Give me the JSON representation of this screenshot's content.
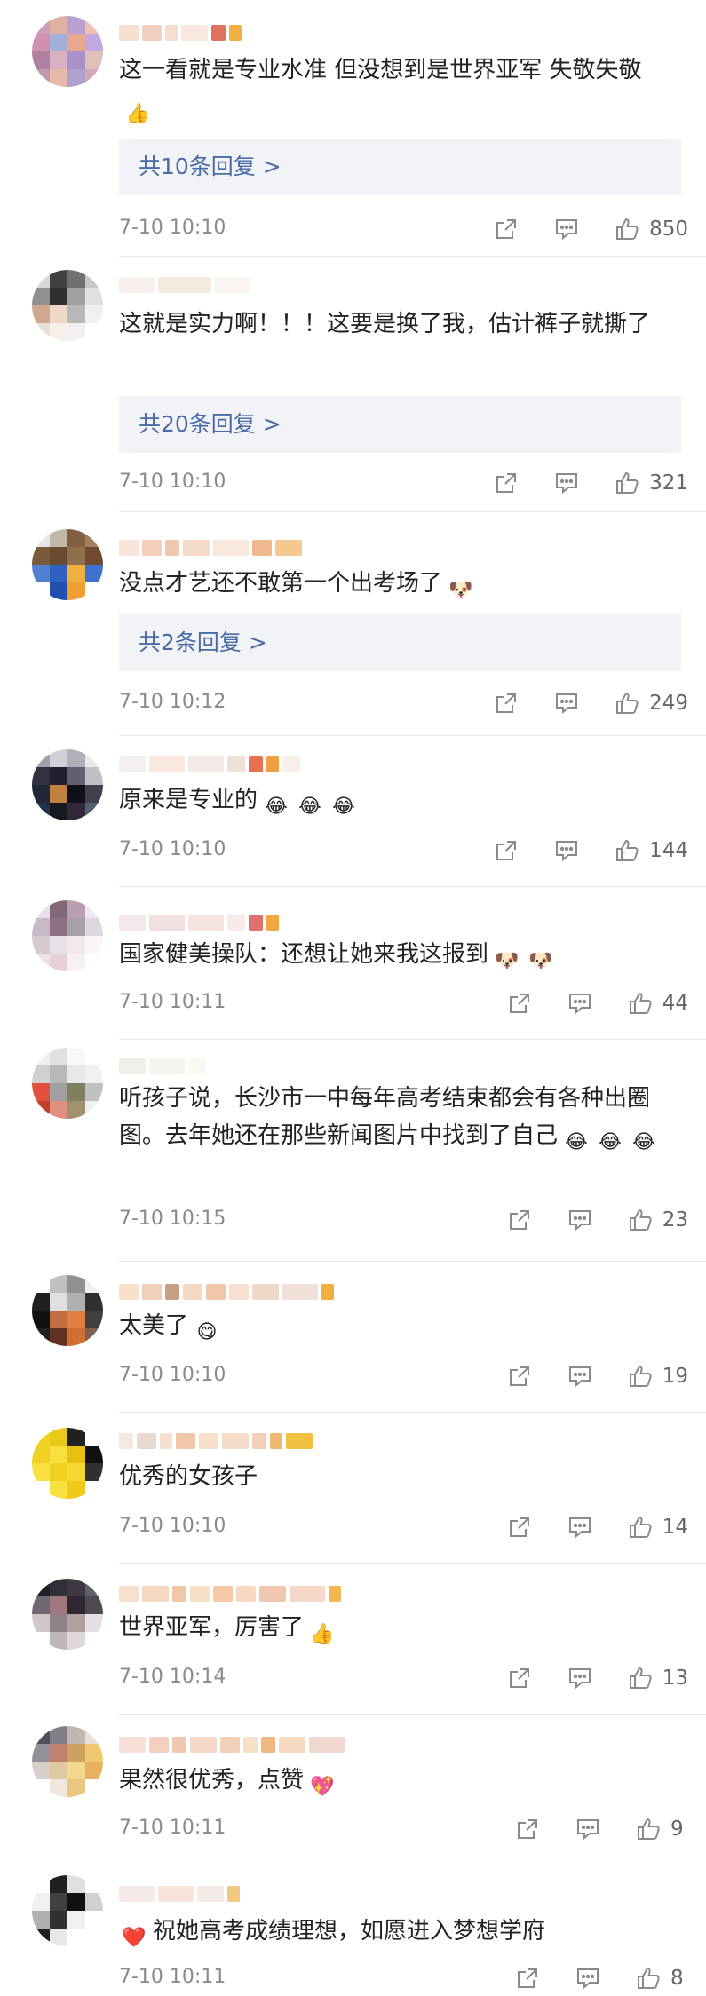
{
  "comments": [
    {
      "text": "这一看就是专业水准 但没想到是世界亚军 失敬失敬",
      "emojis": [
        "👍"
      ],
      "replies": "共10条回复 >",
      "time": "7-10 10:10",
      "likes": "850"
    },
    {
      "text": "这就是实力啊！！！这要是换了我，估计裤子就撕了",
      "emojis": [],
      "replies": "共20条回复 >",
      "time": "7-10 10:10",
      "likes": "321"
    },
    {
      "text": "没点才艺还不敢第一个出考场了",
      "emojis": [
        "🐶"
      ],
      "replies": "共2条回复 >",
      "time": "7-10 10:12",
      "likes": "249"
    },
    {
      "text": "原来是专业的",
      "emojis": [
        "😂",
        "😂",
        "😂"
      ],
      "replies": "",
      "time": "7-10 10:10",
      "likes": "144"
    },
    {
      "text": "国家健美操队：还想让她来我这报到",
      "emojis": [
        "🐶",
        "🐶"
      ],
      "replies": "",
      "time": "7-10 10:11",
      "likes": "44"
    },
    {
      "text": "听孩子说，长沙市一中每年高考结束都会有各种出圈图。去年她还在那些新闻图片中找到了自己",
      "emojis": [
        "😂",
        "😂",
        "😂"
      ],
      "replies": "",
      "time": "7-10 10:15",
      "likes": "23"
    },
    {
      "text": "太美了",
      "emojis": [
        "😋"
      ],
      "replies": "",
      "time": "7-10 10:10",
      "likes": "19"
    },
    {
      "text": "优秀的女孩子",
      "emojis": [],
      "replies": "",
      "time": "7-10 10:10",
      "likes": "14"
    },
    {
      "text": "世界亚军，厉害了",
      "emojis": [
        "👍"
      ],
      "replies": "",
      "time": "7-10 10:14",
      "likes": "13"
    },
    {
      "text": "果然很优秀，点赞",
      "emojis": [
        "💖"
      ],
      "replies": "",
      "time": "7-10 10:11",
      "likes": "9"
    },
    {
      "text": "祝她高考成绩理想，如愿进入梦想学府",
      "emojis": [],
      "prefix_emoji": "❤️",
      "replies": "",
      "time": "7-10 10:11",
      "likes": "8"
    }
  ],
  "icons": {
    "share": "share-icon",
    "comment": "comment-icon",
    "like": "thumbs-up-icon"
  },
  "colors": {
    "reply_link": "#4a6aa5",
    "reply_bg": "#f2f3f6",
    "meta": "#8a8a8a"
  }
}
